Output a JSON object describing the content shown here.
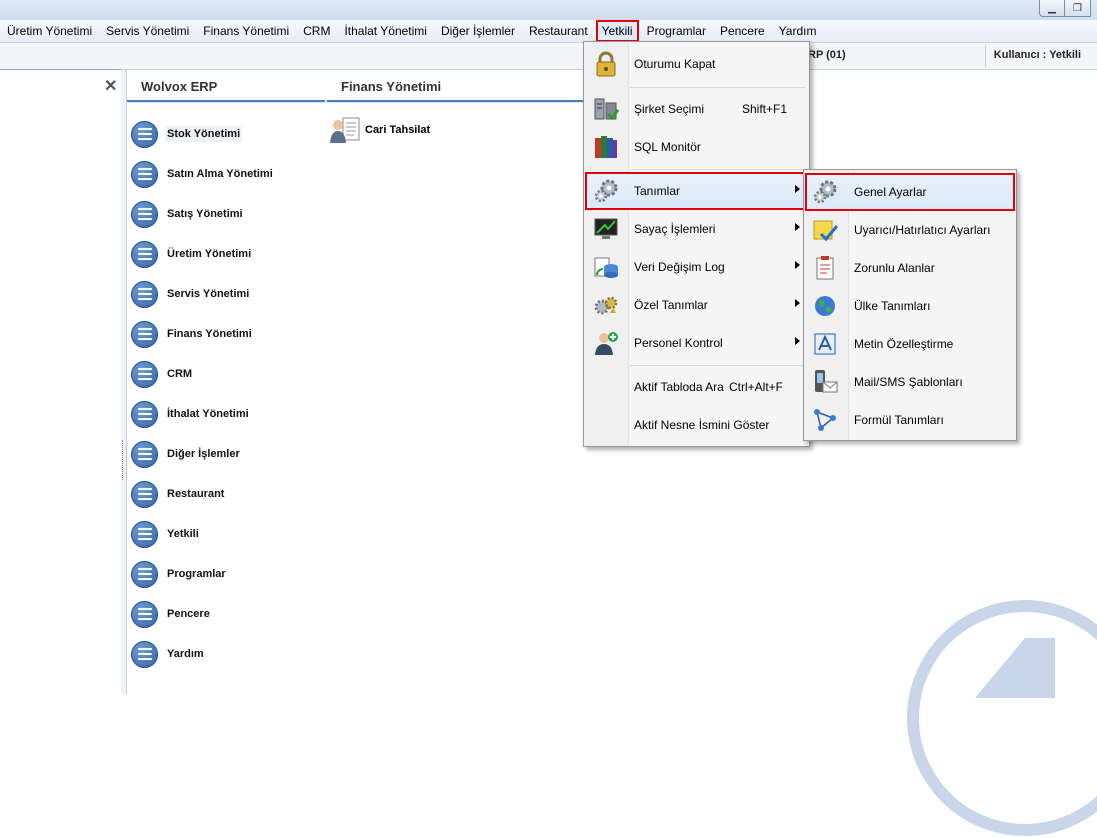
{
  "window": {
    "minimize_symbol": "▁",
    "restore_symbol": "❐"
  },
  "menubar": {
    "items": [
      "Üretim Yönetimi",
      "Servis Yönetimi",
      "Finans Yönetimi",
      "CRM",
      "İthalat Yönetimi",
      "Diğer İşlemler",
      "Restaurant",
      "Yetkili",
      "Programlar",
      "Pencere",
      "Yardım"
    ],
    "active": "Yetkili"
  },
  "infobar": {
    "company": "RP (01)",
    "user": "Kullanıcı : Yetkili"
  },
  "left_panel": {
    "close_symbol": "✕"
  },
  "tabs": {
    "first": "Wolvox ERP",
    "second": "Finans Yönetimi"
  },
  "nav": [
    {
      "label": "Stok Yönetimi"
    },
    {
      "label": "Satın Alma Yönetimi"
    },
    {
      "label": "Satış Yönetimi"
    },
    {
      "label": "Üretim Yönetimi"
    },
    {
      "label": "Servis Yönetimi"
    },
    {
      "label": "Finans Yönetimi"
    },
    {
      "label": "CRM"
    },
    {
      "label": "İthalat Yönetimi"
    },
    {
      "label": "Diğer İşlemler"
    },
    {
      "label": "Restaurant"
    },
    {
      "label": "Yetkili"
    },
    {
      "label": "Programlar"
    },
    {
      "label": "Pencere"
    },
    {
      "label": "Yardım"
    }
  ],
  "finans": {
    "cari_tahsilat": "Cari Tahsilat"
  },
  "yetkili_menu": [
    {
      "label": "Oturumu Kapat",
      "shortcut": "",
      "icon": "lock-icon"
    },
    {
      "label": "Şirket Seçimi",
      "shortcut": "Shift+F1",
      "icon": "company-servers-icon"
    },
    {
      "label": "SQL Monitör",
      "shortcut": "",
      "icon": "books-icon"
    },
    {
      "label": "Tanımlar",
      "shortcut": "",
      "icon": "gears-icon",
      "submenu": true
    },
    {
      "label": "Sayaç İşlemleri",
      "shortcut": "",
      "icon": "monitor-icon",
      "submenu": true
    },
    {
      "label": "Veri Değişim Log",
      "shortcut": "",
      "icon": "data-log-icon",
      "submenu": true
    },
    {
      "label": "Özel Tanımlar",
      "shortcut": "",
      "icon": "custom-gears-icon",
      "submenu": true
    },
    {
      "label": "Personel Kontrol",
      "shortcut": "",
      "icon": "personnel-icon",
      "submenu": true
    },
    {
      "label": "Aktif Tabloda Ara",
      "shortcut": "Ctrl+Alt+F",
      "icon": ""
    },
    {
      "label": "Aktif Nesne İsmini Göster",
      "shortcut": "",
      "icon": ""
    }
  ],
  "tanimlar_submenu": [
    {
      "label": "Genel Ayarlar",
      "icon": "gears-icon"
    },
    {
      "label": "Uyarıcı/Hatırlatıcı Ayarları",
      "icon": "reminder-check-icon"
    },
    {
      "label": "Zorunlu Alanlar",
      "icon": "clipboard-icon"
    },
    {
      "label": "Ülke Tanımları",
      "icon": "globe-icon"
    },
    {
      "label": "Metin Özelleştirme",
      "icon": "text-edit-icon"
    },
    {
      "label": "Mail/SMS Şablonları",
      "icon": "phone-mail-icon"
    },
    {
      "label": "Formül Tanımları",
      "icon": "formula-icon"
    }
  ],
  "colors": {
    "highlight_border": "#e0000a",
    "nav_icon": "#3a6eae",
    "tab_underline": "#4a7ebb"
  }
}
